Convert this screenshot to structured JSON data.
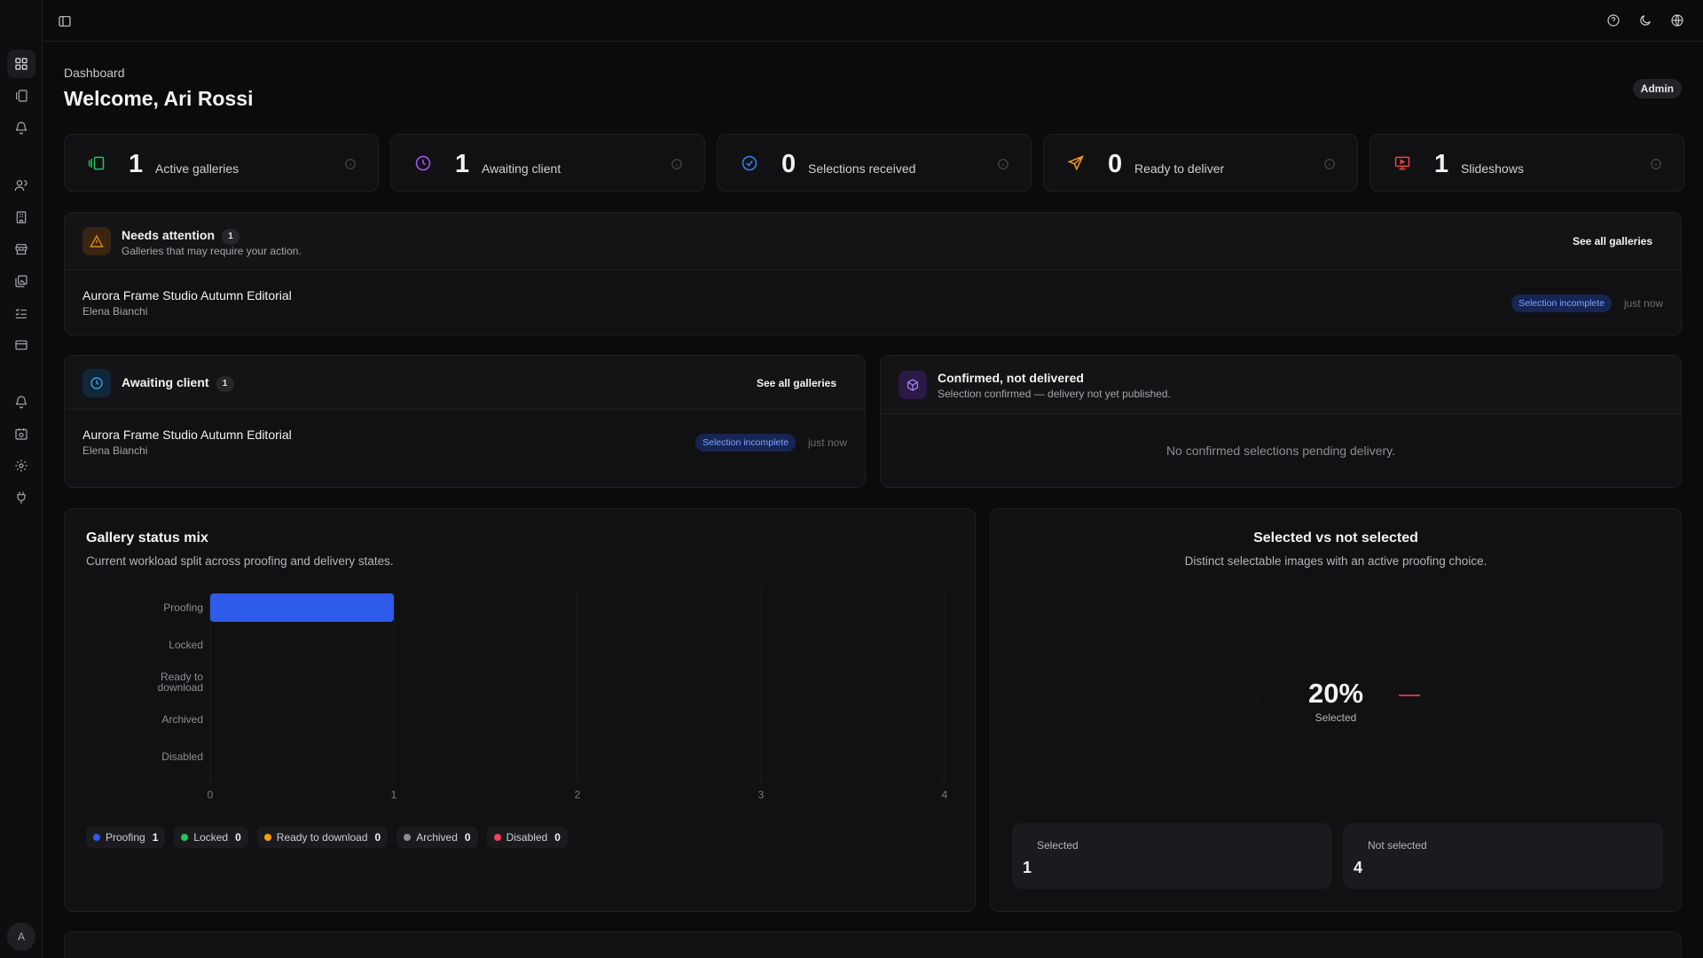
{
  "header": {
    "breadcrumb": "Dashboard",
    "title": "Welcome, Ari Rossi",
    "role": "Admin"
  },
  "stats": [
    {
      "value": "1",
      "label": "Active galleries",
      "icon": "gallery-icon",
      "color": "#22c55e"
    },
    {
      "value": "1",
      "label": "Awaiting client",
      "icon": "clock-icon",
      "color": "#a855f7"
    },
    {
      "value": "0",
      "label": "Selections received",
      "icon": "check-circle-icon",
      "color": "#3b82f6"
    },
    {
      "value": "0",
      "label": "Ready to deliver",
      "icon": "send-icon",
      "color": "#f59e0b"
    },
    {
      "value": "1",
      "label": "Slideshows",
      "icon": "presentation-icon",
      "color": "#ef4444"
    }
  ],
  "needs_attention": {
    "title": "Needs attention",
    "count": "1",
    "subtitle": "Galleries that may require your action.",
    "link": "See all galleries",
    "row": {
      "title": "Aurora Frame Studio Autumn Editorial",
      "client": "Elena Bianchi",
      "status": "Selection incomplete",
      "time": "just now"
    }
  },
  "awaiting": {
    "title": "Awaiting client",
    "count": "1",
    "link": "See all galleries",
    "row": {
      "title": "Aurora Frame Studio Autumn Editorial",
      "client": "Elena Bianchi",
      "status": "Selection incomplete",
      "time": "just now"
    }
  },
  "confirmed": {
    "title": "Confirmed, not delivered",
    "subtitle": "Selection confirmed — delivery not yet published.",
    "empty": "No confirmed selections pending delivery."
  },
  "status_mix": {
    "title": "Gallery status mix",
    "subtitle": "Current workload split across proofing and delivery states.",
    "legend": [
      {
        "name": "Proofing",
        "count": "1",
        "color": "#2f5bea"
      },
      {
        "name": "Locked",
        "count": "0",
        "color": "#22c55e"
      },
      {
        "name": "Ready to download",
        "count": "0",
        "color": "#f59e0b"
      },
      {
        "name": "Archived",
        "count": "0",
        "color": "#8d8d94"
      },
      {
        "name": "Disabled",
        "count": "0",
        "color": "#f43f5e"
      }
    ]
  },
  "chart_data": {
    "type": "bar",
    "orientation": "horizontal",
    "categories": [
      "Proofing",
      "Locked",
      "Ready to\ndownload",
      "Archived",
      "Disabled"
    ],
    "values": [
      1,
      0,
      0,
      0,
      0
    ],
    "xlim": [
      0,
      4
    ],
    "xticks": [
      "0",
      "1",
      "2",
      "3",
      "4"
    ],
    "grid": true,
    "bar_color": "#2f5bea"
  },
  "selected": {
    "title": "Selected vs not selected",
    "subtitle": "Distinct selectable images with an active proofing choice.",
    "pct": "20%",
    "pct_caption": "Selected",
    "fraction": 0.2,
    "accent": "#f43f5e",
    "cards": [
      {
        "label": "Selected",
        "value": "1"
      },
      {
        "label": "Not selected",
        "value": "4"
      }
    ]
  }
}
